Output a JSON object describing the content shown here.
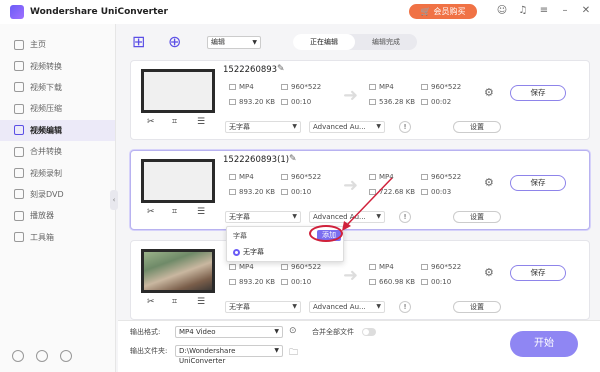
{
  "app": {
    "title": "Wondershare UniConverter",
    "buy_label": "会员购买"
  },
  "colors": {
    "accent": "#6a5cf6",
    "buy": "#f07245",
    "annotation": "#d0213b"
  },
  "sidebar": {
    "items": [
      {
        "label": "主页"
      },
      {
        "label": "视频转换"
      },
      {
        "label": "视频下载"
      },
      {
        "label": "视频压缩"
      },
      {
        "label": "视频编辑",
        "active": true
      },
      {
        "label": "合并转换"
      },
      {
        "label": "视频录制"
      },
      {
        "label": "刻录DVD"
      },
      {
        "label": "播放器"
      },
      {
        "label": "工具箱"
      }
    ]
  },
  "toolbar": {
    "mode": "编辑",
    "tab_editing": "正在编辑",
    "tab_done": "编辑完成"
  },
  "cards": [
    {
      "filename": "1522260893",
      "src": {
        "format": "MP4",
        "resolution": "960*522",
        "size": "893.20 KB",
        "duration": "00:10"
      },
      "out": {
        "format": "MP4",
        "resolution": "960*522",
        "size": "536.28 KB",
        "duration": "00:02"
      },
      "subtitle": "无字幕",
      "audio": "Advanced Au...",
      "settings": "设置",
      "save": "保存"
    },
    {
      "filename": "1522260893(1)",
      "src": {
        "format": "MP4",
        "resolution": "960*522",
        "size": "893.20 KB",
        "duration": "00:10"
      },
      "out": {
        "format": "MP4",
        "resolution": "960*522",
        "size": "722.68 KB",
        "duration": "00:03"
      },
      "subtitle": "无字幕",
      "audio": "Advanced Au...",
      "settings": "设置",
      "save": "保存"
    },
    {
      "filename": "",
      "src": {
        "format": "MP4",
        "resolution": "960*522",
        "size": "893.20 KB",
        "duration": "00:10"
      },
      "out": {
        "format": "MP4",
        "resolution": "960*522",
        "size": "660.98 KB",
        "duration": "00:10"
      },
      "subtitle": "无字幕",
      "audio": "Advanced Au...",
      "settings": "设置",
      "save": "保存"
    }
  ],
  "popup": {
    "header": "字幕",
    "add": "添加",
    "option": "无字幕"
  },
  "bottom": {
    "format_label": "输出格式:",
    "format_value": "MP4 Video",
    "folder_label": "输出文件夹:",
    "folder_value": "D:\\Wondershare UniConverter",
    "merge_label": "合并全部文件",
    "start": "开始"
  }
}
